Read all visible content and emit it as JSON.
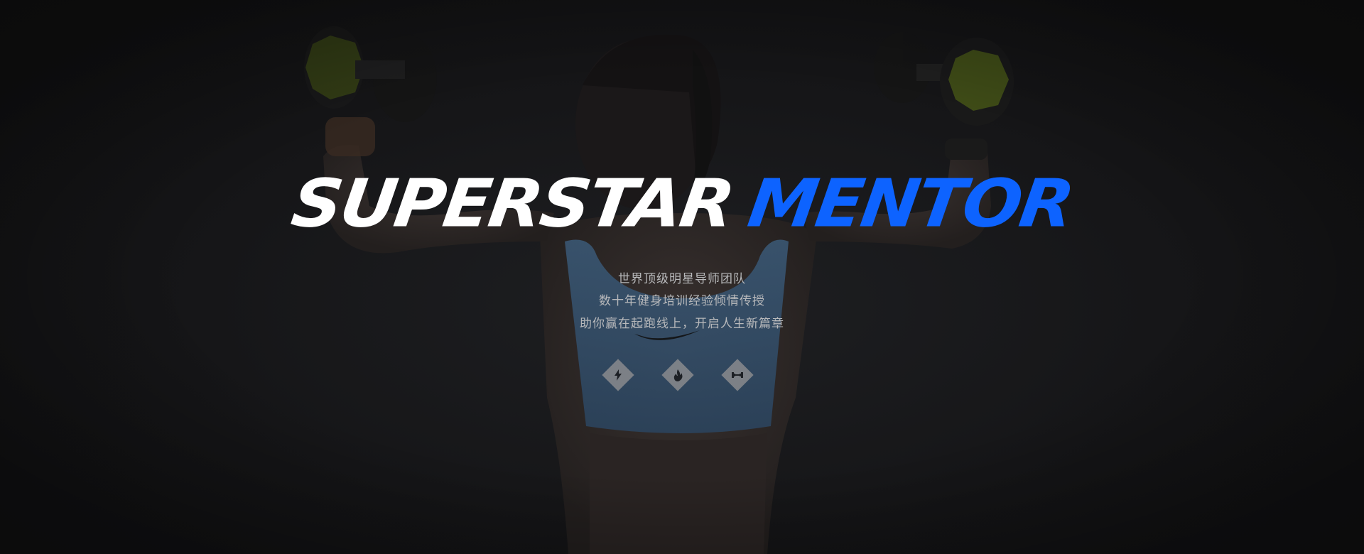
{
  "hero": {
    "headline_part1": "SUPERSTAR",
    "headline_part2": "MENTOR",
    "subtitle_lines": [
      "世界顶级明星导师团队",
      "数十年健身培训经验倾情传授",
      "助你赢在起跑线上，开启人生新篇章"
    ],
    "icons": [
      "lightning-icon",
      "flame-icon",
      "dumbbell-icon"
    ],
    "accent_color": "#0d63ff",
    "background_color": "#121213"
  }
}
